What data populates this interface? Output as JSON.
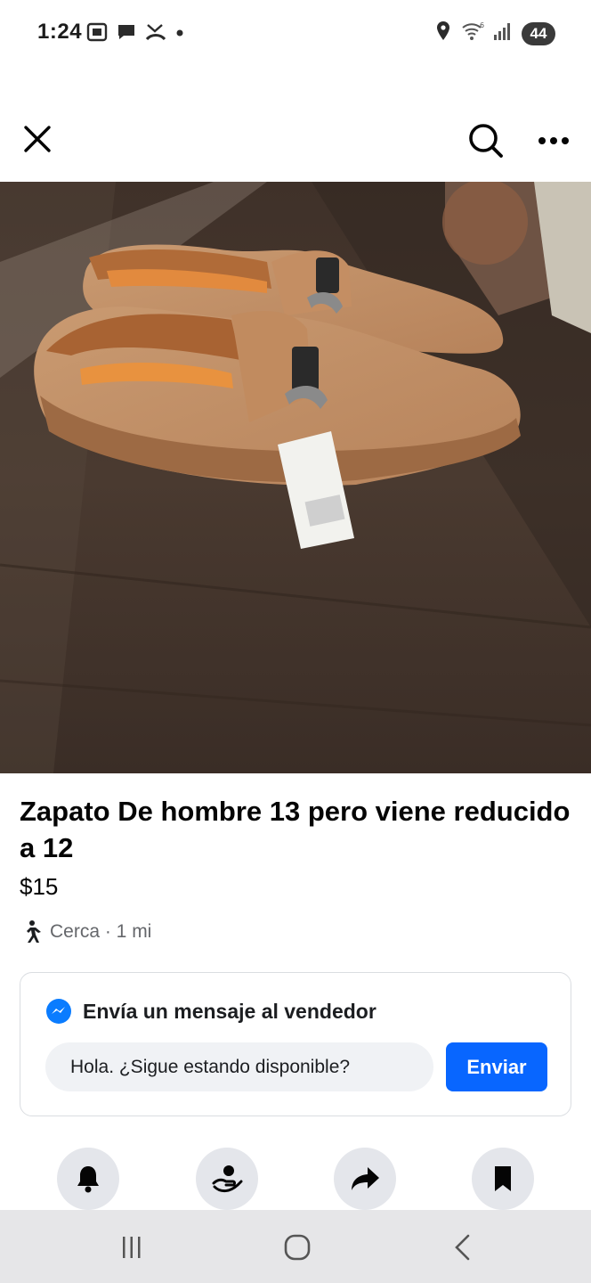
{
  "status_bar": {
    "time": "1:24",
    "battery": "44",
    "left_icons": [
      "screenshot-icon",
      "chat-bubble-icon",
      "missed-call-icon",
      "dot-icon"
    ],
    "right_icons": [
      "location-pin-icon",
      "wifi-icon",
      "signal-icon",
      "battery-icon"
    ]
  },
  "header": {
    "close_icon": "close-icon",
    "search_icon": "search-icon",
    "more_icon": "more-icon"
  },
  "listing": {
    "title": "Zapato De hombre 13 pero viene reducido a 12",
    "price": "$15",
    "location": "Cerca · 1 mi",
    "location_icon": "walking-person-icon"
  },
  "message_box": {
    "heading": "Envía un mensaje al vendedor",
    "input_value": "Hola. ¿Sigue estando disponible?",
    "send_label": "Enviar",
    "messenger_icon": "messenger-icon"
  },
  "actions": [
    {
      "icon": "bell-icon"
    },
    {
      "icon": "hand-person-icon"
    },
    {
      "icon": "share-icon"
    },
    {
      "icon": "bookmark-icon"
    }
  ],
  "nav_bar": {
    "items": [
      "recent-apps-icon",
      "home-icon",
      "back-icon"
    ]
  },
  "colors": {
    "accent": "#0866ff",
    "messenger": "#0a7cff",
    "secondary_text": "#65676b",
    "circle_bg": "#e4e6eb"
  }
}
